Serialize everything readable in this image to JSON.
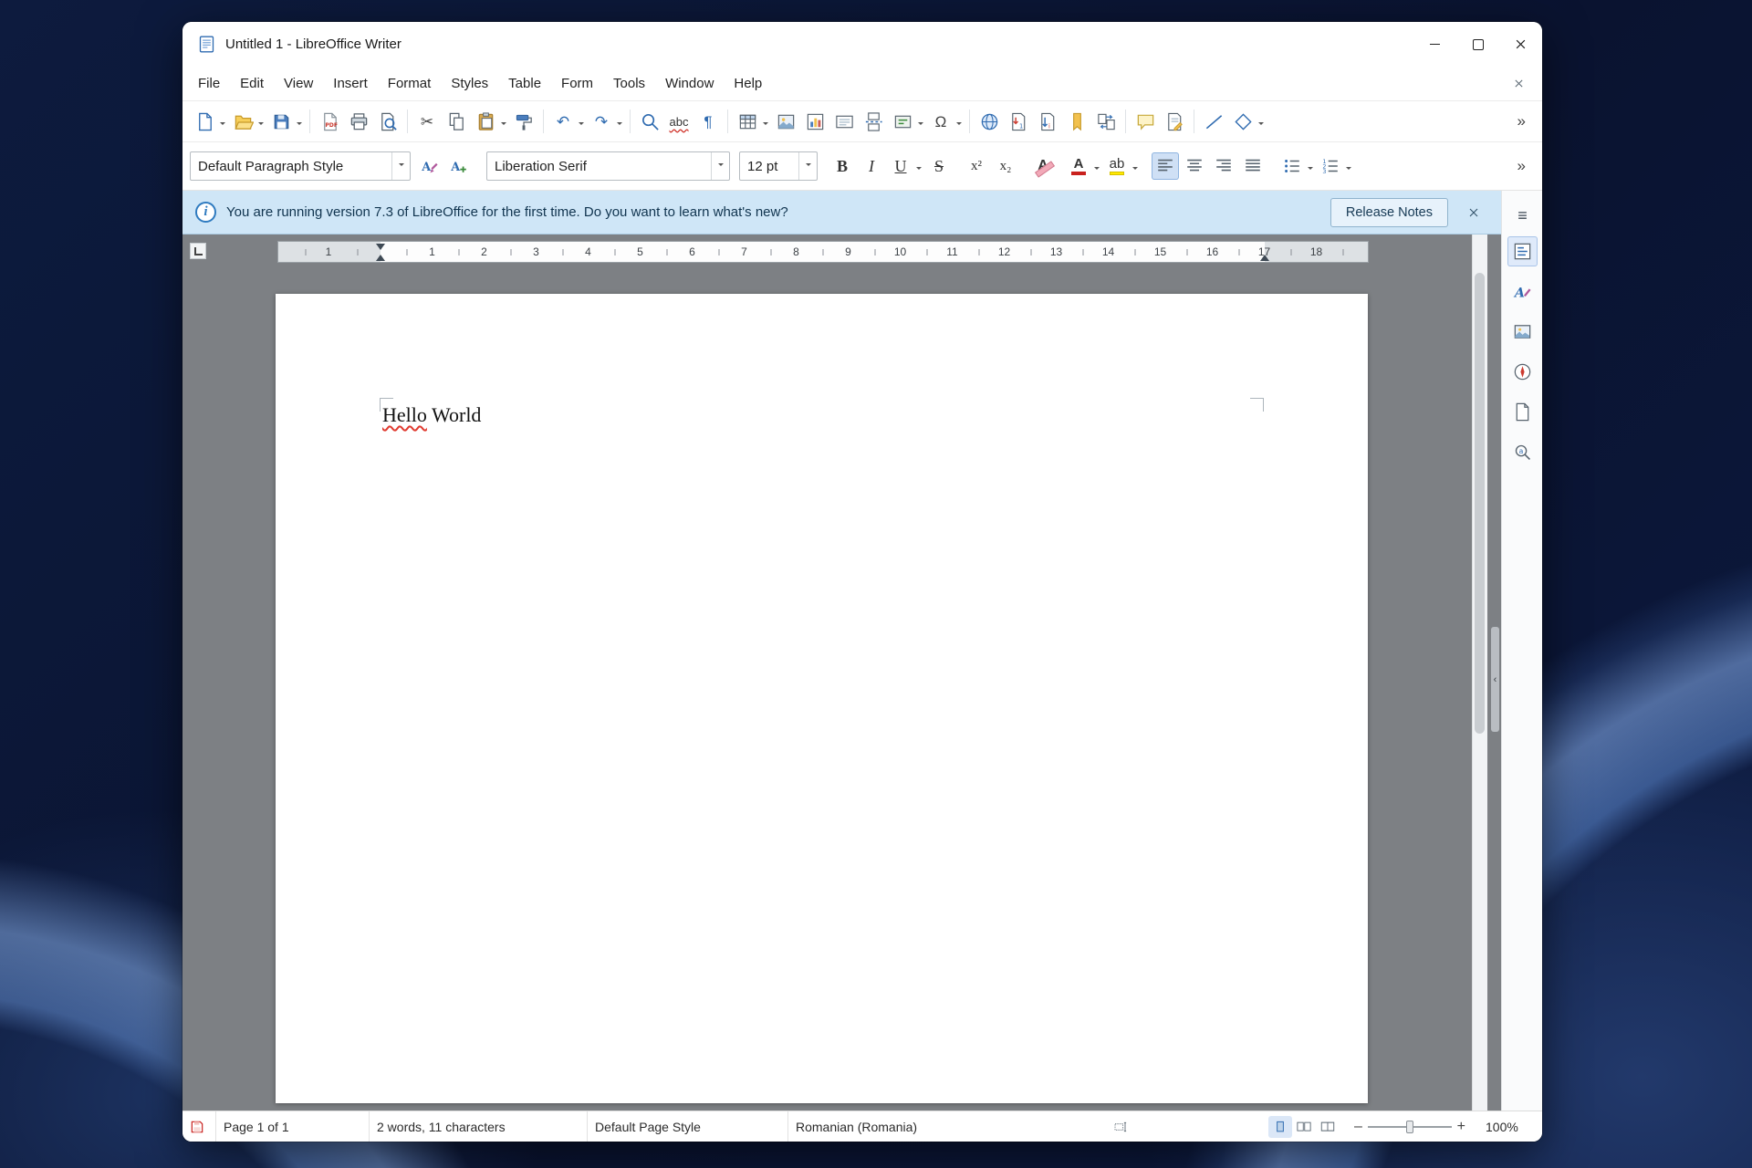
{
  "window": {
    "title": "Untitled 1 - LibreOffice Writer"
  },
  "menubar": {
    "items": [
      "File",
      "Edit",
      "View",
      "Insert",
      "Format",
      "Styles",
      "Table",
      "Form",
      "Tools",
      "Window",
      "Help"
    ]
  },
  "icons": {
    "cut": "✂",
    "undo": "↶",
    "redo": "↷",
    "spelling": "abc",
    "paragraph_marks": "¶",
    "special_character": "Ω",
    "more": "»",
    "bold": "B",
    "italic": "I",
    "underline": "U",
    "strikethrough": "S",
    "superscript": "x²",
    "subscript": "x₂",
    "clear_formatting": "A",
    "font_color": "A",
    "highlight": "ab",
    "hamburger": "≡",
    "info": "i",
    "zoom_out": "–",
    "zoom_in": "+",
    "collapse": "‹"
  },
  "formatting": {
    "paragraph_style": "Default Paragraph Style",
    "font_name": "Liberation Serif",
    "font_size": "12 pt"
  },
  "infobar": {
    "message": "You are running version 7.3 of LibreOffice for the first time. Do you want to learn what's new?",
    "button": "Release Notes"
  },
  "ruler": {
    "margin_number": "1",
    "numbers": [
      "1",
      "2",
      "3",
      "4",
      "5",
      "6",
      "7",
      "8",
      "9",
      "10",
      "11",
      "12",
      "13",
      "14",
      "15",
      "16",
      "17",
      "18"
    ]
  },
  "document": {
    "misspelled_word": "Hello",
    "rest": " World"
  },
  "statusbar": {
    "page": "Page 1 of 1",
    "words": "2 words, 11 characters",
    "page_style": "Default Page Style",
    "language": "Romanian (Romania)",
    "zoom": "100%"
  }
}
